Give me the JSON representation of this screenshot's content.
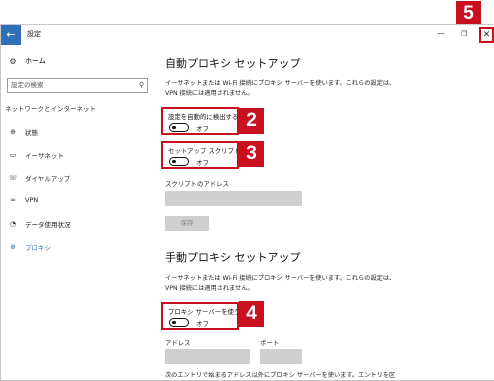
{
  "window": {
    "back": "←",
    "title": "設定",
    "minimize": "—",
    "maximize": "❐",
    "close": "✕"
  },
  "sidebar": {
    "home": "ホーム",
    "search_placeholder": "設定の検索",
    "group": "ネットワークとインターネット",
    "items": [
      {
        "label": "状態",
        "icon": "globe-icon"
      },
      {
        "label": "イーサネット",
        "icon": "ethernet-icon"
      },
      {
        "label": "ダイヤルアップ",
        "icon": "dialup-icon"
      },
      {
        "label": "VPN",
        "icon": "vpn-icon"
      },
      {
        "label": "データ使用状況",
        "icon": "data-usage-icon"
      },
      {
        "label": "プロキシ",
        "icon": "globe-icon"
      }
    ]
  },
  "auto": {
    "heading": "自動プロキシ セットアップ",
    "desc1": "イーサネットまたは Wi-Fi 接続にプロキシ サーバーを使います。これらの設定は、",
    "desc2": "VPN 接続には適用されません。",
    "detect_label": "設定を自動的に検出する",
    "detect_state": "オフ",
    "script_label": "セットアップ スクリプトを使う",
    "script_state": "オフ",
    "address_label": "スクリプトのアドレス",
    "save": "保存"
  },
  "manual": {
    "heading": "手動プロキシ セットアップ",
    "desc1": "イーサネットまたは Wi-Fi 接続にプロキシ サーバーを使います。これらの設定は、",
    "desc2": "VPN 接続には適用されません。",
    "use_label": "プロキシ サーバーを使う",
    "use_state": "オフ",
    "address_label": "アドレス",
    "port_label": "ポート",
    "footer": "次のエントリで始まるアドレス以外にプロキシ サーバーを使います。エントリを区"
  },
  "badges": {
    "b2": "2",
    "b3": "3",
    "b4": "4",
    "b5": "5"
  },
  "colors": {
    "accent": "#2f70b8",
    "highlight": "#c8101e",
    "field": "#cfcfcf"
  }
}
